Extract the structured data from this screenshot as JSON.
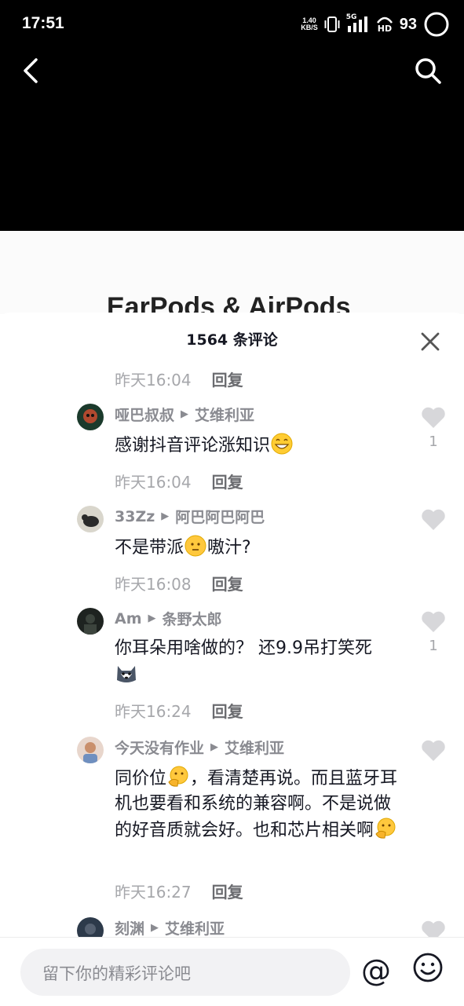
{
  "status_bar": {
    "time": "17:51",
    "speed_value": "1.40",
    "speed_unit": "KB/S",
    "network_label": "5G",
    "hd_label": "HD",
    "battery": "93"
  },
  "video": {
    "preview_text": "EarPods & AirPods"
  },
  "comments_panel": {
    "title": "1564 条评论",
    "top_meta": {
      "time": "昨天16:04",
      "reply": "回复"
    },
    "comments": [
      {
        "user": "哑巴叔叔",
        "reply_to": "艾维利亚",
        "text": "感谢抖音评论涨知识",
        "emoji": "grin-emoji",
        "time": "昨天16:04",
        "reply": "回复",
        "likes": "1"
      },
      {
        "user": "33Zz",
        "reply_to": "阿巴阿巴阿巴",
        "text_before": "不是带派",
        "emoji": "face-emoji",
        "text_after": "嗷汁?",
        "time": "昨天16:08",
        "reply": "回复",
        "likes": ""
      },
      {
        "user": "Am",
        "reply_to": "条野太郎",
        "text": "你耳朵用啥做的？ 还9.9吊打笑死",
        "emoji": "husky-emoji",
        "time": "昨天16:24",
        "reply": "回复",
        "likes": "1"
      },
      {
        "user": "今天没有作业",
        "reply_to": "艾维利亚",
        "text_before": "同价位",
        "emoji": "thinking-emoji",
        "text_mid": "，看清楚再说。而且蓝牙耳机也要看和系统的兼容啊。不是说做的好音质就会好。也和芯片相关啊",
        "time": "昨天16:27",
        "reply": "回复",
        "likes": ""
      },
      {
        "user": "刻渊",
        "reply_to": "艾维利亚"
      }
    ]
  },
  "input": {
    "placeholder": "留下你的精彩评论吧",
    "at_label": "@"
  }
}
